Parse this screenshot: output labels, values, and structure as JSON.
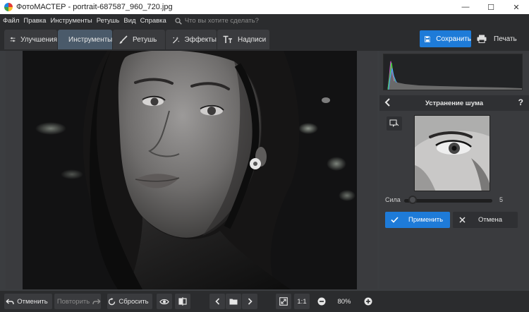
{
  "window": {
    "title": "ФотоМАСТЕР - portrait-687587_960_720.jpg",
    "minimize": "—",
    "maximize": "☐",
    "close": "✕"
  },
  "menu": {
    "items": [
      "Файл",
      "Правка",
      "Инструменты",
      "Ретушь",
      "Вид",
      "Справка"
    ],
    "search_placeholder": "Что вы хотите сделать?"
  },
  "tabs": [
    {
      "label": "Улучшения",
      "active": false
    },
    {
      "label": "Инструменты",
      "active": true
    },
    {
      "label": "Ретушь",
      "active": false
    },
    {
      "label": "Эффекты",
      "active": false
    },
    {
      "label": "Надписи",
      "active": false
    }
  ],
  "toolbar": {
    "save_label": "Сохранить",
    "print_label": "Печать"
  },
  "panel": {
    "title": "Устранение шума",
    "help": "?",
    "strength_label": "Сила",
    "strength_value": "5",
    "strength_fraction": 0.05,
    "apply_label": "Применить",
    "cancel_label": "Отмена"
  },
  "bottom": {
    "undo_label": "Отменить",
    "redo_label": "Повторить",
    "reset_label": "Сбросить",
    "ratio_label": "1:1",
    "zoom_value": "80%"
  },
  "colors": {
    "accent": "#1e7bd8",
    "panel": "#3a3b3e",
    "chrome": "#2b2c2e"
  }
}
